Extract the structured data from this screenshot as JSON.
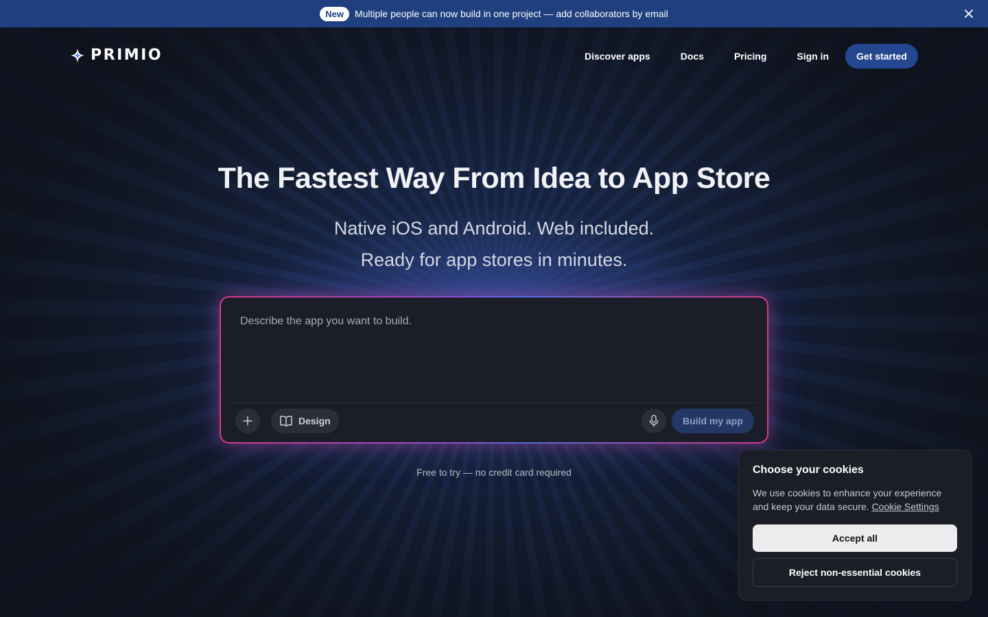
{
  "announcement": {
    "badge": "New",
    "text": "Multiple people can now build in one project — add collaborators by email",
    "close_icon": "close-icon"
  },
  "header": {
    "logo_text": "PRIMIO",
    "logo_icon": "sparkle-icon",
    "nav": {
      "discover": "Discover apps",
      "docs": "Docs",
      "pricing": "Pricing",
      "signin": "Sign in",
      "get_started": "Get started"
    }
  },
  "hero": {
    "title": "The Fastest Way From Idea to App Store",
    "subtitle_line1": "Native iOS and Android. Web included.",
    "subtitle_line2": "Ready for app stores in minutes."
  },
  "prompt": {
    "value": "",
    "placeholder": "Describe the app you want to build.",
    "design_label": "Design",
    "build_label": "Build my app",
    "icons": [
      "plus-icon",
      "book-icon",
      "microphone-icon"
    ]
  },
  "free_note": "Free to try — no credit card required",
  "cookies": {
    "title": "Choose your cookies",
    "text": "We use cookies to enhance your experience and keep your data secure.",
    "link": "Cookie Settings",
    "accept": "Accept all",
    "reject": "Reject non-essential cookies"
  },
  "colors": {
    "announcement_bg": "#1f3f7f",
    "primary_button": "#24478f",
    "page_bg": "#111622",
    "prompt_glow_pink": "#d63c8a",
    "prompt_glow_blue": "#4f6fe0"
  }
}
